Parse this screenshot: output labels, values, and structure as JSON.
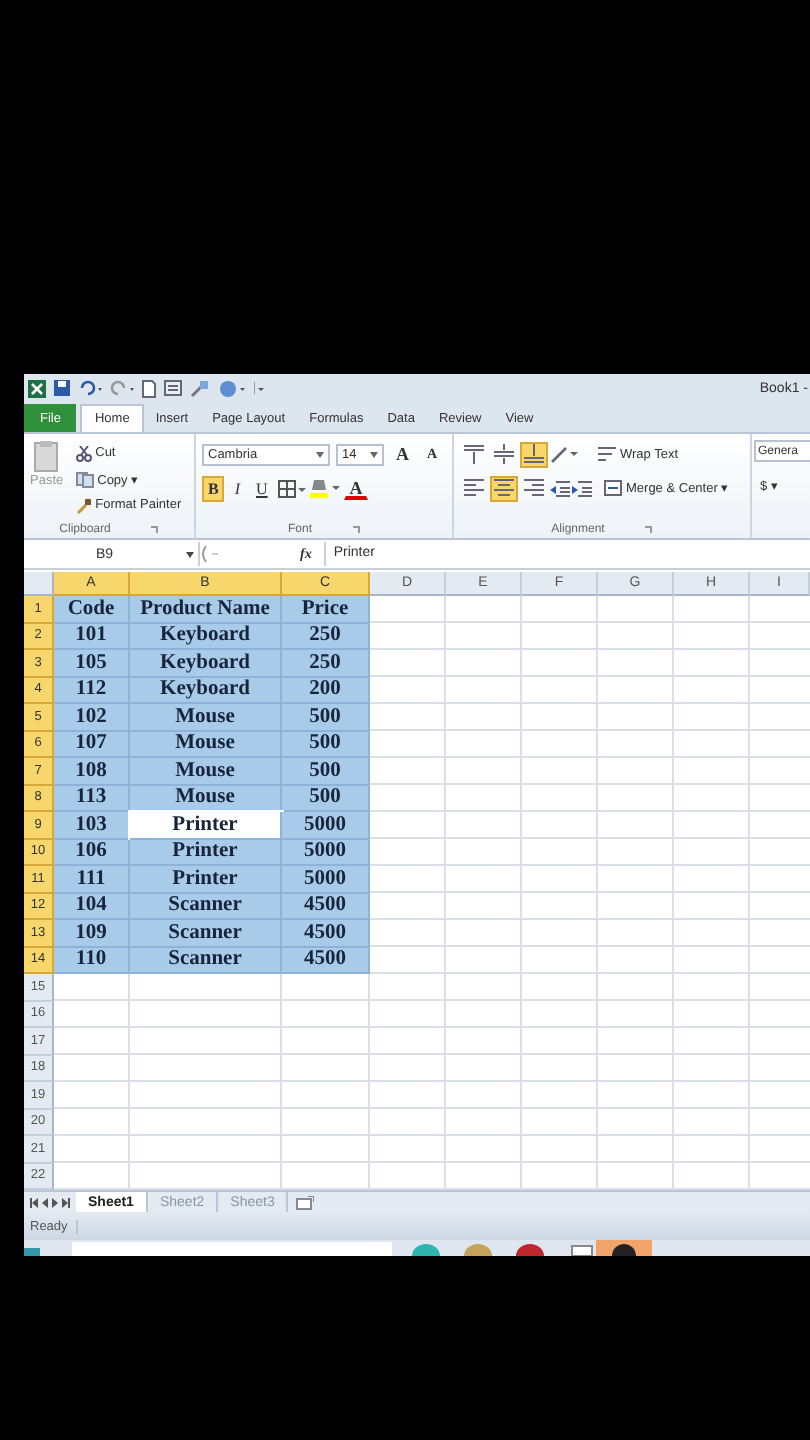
{
  "window": {
    "title": "Book1 -"
  },
  "tabs": [
    {
      "label": "File",
      "kind": "file",
      "selected": false
    },
    {
      "label": "Home",
      "kind": "tab",
      "selected": true
    },
    {
      "label": "Insert",
      "kind": "tab",
      "selected": false
    },
    {
      "label": "Page Layout",
      "kind": "tab",
      "selected": false
    },
    {
      "label": "Formulas",
      "kind": "tab",
      "selected": false
    },
    {
      "label": "Data",
      "kind": "tab",
      "selected": false
    },
    {
      "label": "Review",
      "kind": "tab",
      "selected": false
    },
    {
      "label": "View",
      "kind": "tab",
      "selected": false
    }
  ],
  "ribbon": {
    "clipboard": {
      "label": "Clipboard",
      "paste": "Paste",
      "cut": "Cut",
      "copy": "Copy ▾",
      "format_painter": "Format Painter"
    },
    "font": {
      "label": "Font",
      "font_name": "Cambria",
      "font_size": "14",
      "grow": "A",
      "shrink": "A",
      "styles": [
        {
          "label": "B",
          "kind": "bold",
          "selected": true
        },
        {
          "label": "I",
          "kind": "italic",
          "selected": false
        },
        {
          "label": "U",
          "kind": "underline",
          "selected": false
        }
      ],
      "font_color": "A"
    },
    "alignment": {
      "label": "Alignment",
      "vertical": [
        {
          "kind": "top",
          "selected": false
        },
        {
          "kind": "middle",
          "selected": false
        },
        {
          "kind": "bottom",
          "selected": true
        }
      ],
      "horizontal": [
        {
          "kind": "left",
          "selected": false
        },
        {
          "kind": "center",
          "selected": true
        },
        {
          "kind": "right",
          "selected": false
        }
      ],
      "wrap_text": "Wrap Text",
      "merge": "Merge & Center ▾"
    },
    "number": {
      "format": "Genera",
      "currency": "$ ▾"
    }
  },
  "formula_bar": {
    "name_box": "B9",
    "function_label": "fx",
    "value": "Printer"
  },
  "table": {
    "columns": [
      {
        "label": "A",
        "selected": true
      },
      {
        "label": "B",
        "selected": true
      },
      {
        "label": "C",
        "selected": true
      },
      {
        "label": "D",
        "selected": false
      },
      {
        "label": "E",
        "selected": false
      },
      {
        "label": "F",
        "selected": false
      },
      {
        "label": "G",
        "selected": false
      },
      {
        "label": "H",
        "selected": false
      },
      {
        "label": "I",
        "selected": false
      }
    ],
    "rows": [
      {
        "label": "1",
        "selected": true,
        "cells": [
          {
            "text": "Code",
            "active": false
          },
          {
            "text": "Product Name",
            "active": false
          },
          {
            "text": "Price",
            "active": false
          }
        ]
      },
      {
        "label": "2",
        "selected": true,
        "cells": [
          {
            "text": "101",
            "active": false
          },
          {
            "text": "Keyboard",
            "active": false
          },
          {
            "text": "250",
            "active": false
          }
        ]
      },
      {
        "label": "3",
        "selected": true,
        "cells": [
          {
            "text": "105",
            "active": false
          },
          {
            "text": "Keyboard",
            "active": false
          },
          {
            "text": "250",
            "active": false
          }
        ]
      },
      {
        "label": "4",
        "selected": true,
        "cells": [
          {
            "text": "112",
            "active": false
          },
          {
            "text": "Keyboard",
            "active": false
          },
          {
            "text": "200",
            "active": false
          }
        ]
      },
      {
        "label": "5",
        "selected": true,
        "cells": [
          {
            "text": "102",
            "active": false
          },
          {
            "text": "Mouse",
            "active": false
          },
          {
            "text": "500",
            "active": false
          }
        ]
      },
      {
        "label": "6",
        "selected": true,
        "cells": [
          {
            "text": "107",
            "active": false
          },
          {
            "text": "Mouse",
            "active": false
          },
          {
            "text": "500",
            "active": false
          }
        ]
      },
      {
        "label": "7",
        "selected": true,
        "cells": [
          {
            "text": "108",
            "active": false
          },
          {
            "text": "Mouse",
            "active": false
          },
          {
            "text": "500",
            "active": false
          }
        ]
      },
      {
        "label": "8",
        "selected": true,
        "cells": [
          {
            "text": "113",
            "active": false
          },
          {
            "text": "Mouse",
            "active": false
          },
          {
            "text": "500",
            "active": false
          }
        ]
      },
      {
        "label": "9",
        "selected": true,
        "cells": [
          {
            "text": "103",
            "active": false
          },
          {
            "text": "Printer",
            "active": true
          },
          {
            "text": "5000",
            "active": false
          }
        ]
      },
      {
        "label": "10",
        "selected": true,
        "cells": [
          {
            "text": "106",
            "active": false
          },
          {
            "text": "Printer",
            "active": false
          },
          {
            "text": "5000",
            "active": false
          }
        ]
      },
      {
        "label": "11",
        "selected": true,
        "cells": [
          {
            "text": "111",
            "active": false
          },
          {
            "text": "Printer",
            "active": false
          },
          {
            "text": "5000",
            "active": false
          }
        ]
      },
      {
        "label": "12",
        "selected": true,
        "cells": [
          {
            "text": "104",
            "active": false
          },
          {
            "text": "Scanner",
            "active": false
          },
          {
            "text": "4500",
            "active": false
          }
        ]
      },
      {
        "label": "13",
        "selected": true,
        "cells": [
          {
            "text": "109",
            "active": false
          },
          {
            "text": "Scanner",
            "active": false
          },
          {
            "text": "4500",
            "active": false
          }
        ]
      },
      {
        "label": "14",
        "selected": true,
        "cells": [
          {
            "text": "110",
            "active": false
          },
          {
            "text": "Scanner",
            "active": false
          },
          {
            "text": "4500",
            "active": false
          }
        ]
      },
      {
        "label": "15",
        "selected": false,
        "cells": []
      },
      {
        "label": "16",
        "selected": false,
        "cells": []
      },
      {
        "label": "17",
        "selected": false,
        "cells": []
      },
      {
        "label": "18",
        "selected": false,
        "cells": []
      },
      {
        "label": "19",
        "selected": false,
        "cells": []
      },
      {
        "label": "20",
        "selected": false,
        "cells": []
      },
      {
        "label": "21",
        "selected": false,
        "cells": []
      },
      {
        "label": "22",
        "selected": false,
        "cells": []
      }
    ]
  },
  "sheets": [
    {
      "label": "Sheet1",
      "selected": true
    },
    {
      "label": "Sheet2",
      "selected": false
    },
    {
      "label": "Sheet3",
      "selected": false
    }
  ],
  "status_bar": {
    "text": "Ready"
  }
}
